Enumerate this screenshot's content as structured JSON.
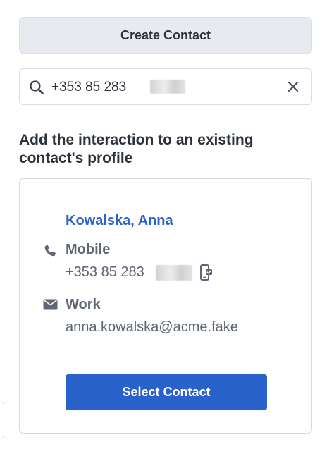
{
  "create_contact_label": "Create Contact",
  "search": {
    "value": "+353 85 283",
    "redacted_part": true
  },
  "section_heading": "Add the interaction to an existing contact's profile",
  "contact": {
    "name": "Kowalska, Anna",
    "phone_type": "Mobile",
    "phone_number": "+353 85 283",
    "email_type": "Work",
    "email": "anna.kowalska@acme.fake",
    "select_label": "Select Contact"
  },
  "icons": {
    "search": "search-icon",
    "clear": "close-icon",
    "phone": "phone-icon",
    "mobile_device": "mobile-device-icon",
    "mail": "envelope-icon"
  },
  "colors": {
    "link": "#2c62c8",
    "primary_button": "#2a62cb",
    "secondary_button": "#e7eaee",
    "label_text": "#5d6672"
  }
}
